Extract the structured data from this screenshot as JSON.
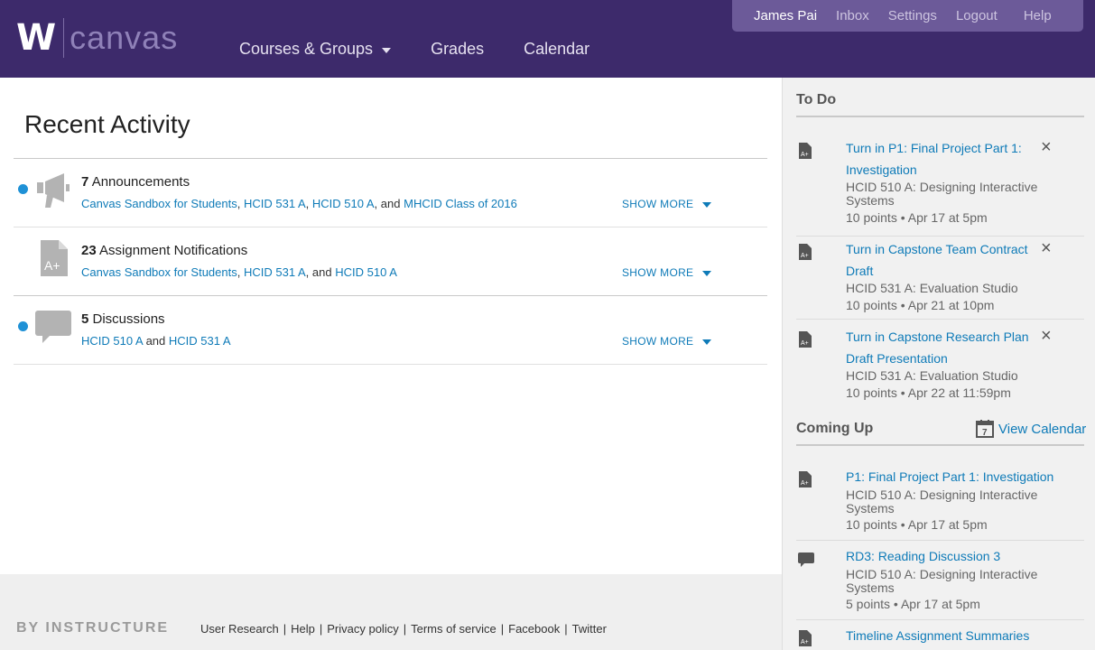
{
  "header": {
    "logo_mark": "W",
    "logo_text": "canvas",
    "nav": [
      {
        "label": "Courses & Groups"
      },
      {
        "label": "Grades"
      },
      {
        "label": "Calendar"
      }
    ],
    "user_nav": {
      "user": "James Pai",
      "inbox": "Inbox",
      "settings": "Settings",
      "logout": "Logout",
      "help": "Help"
    },
    "colors": {
      "bar": "#3d2a6b",
      "user_bar": "#6c5a99"
    }
  },
  "main": {
    "title": "Recent Activity",
    "activities": [
      {
        "count": "7",
        "label": "Announcements",
        "icon": "megaphone-icon",
        "links": [
          "Canvas Sandbox for Students",
          "HCID 531 A",
          "HCID 510 A",
          "MHCID Class of 2016"
        ],
        "show_more": "SHOW MORE",
        "unread": true
      },
      {
        "count": "23",
        "label": "Assignment Notifications",
        "icon": "assignment-icon",
        "links": [
          "Canvas Sandbox for Students",
          "HCID 531 A",
          "HCID 510 A"
        ],
        "show_more": "SHOW MORE",
        "unread": false
      },
      {
        "count": "5",
        "label": "Discussions",
        "icon": "discussion-icon",
        "links": [
          "HCID 510 A",
          "HCID 531 A"
        ],
        "show_more": "SHOW MORE",
        "unread": true
      }
    ],
    "separators": {
      "comma": ",",
      "and": "and"
    }
  },
  "footer": {
    "brand": "BY INSTRUCTURE",
    "links": [
      "User Research",
      "Help",
      "Privacy policy",
      "Terms of service",
      "Facebook",
      "Twitter"
    ]
  },
  "sidebar": {
    "todo_heading": "To Do",
    "todo": [
      {
        "title_line1": "Turn in P1: Final Project Part 1:",
        "title_line2": "Investigation",
        "course": "HCID 510 A: Designing Interactive Systems",
        "meta": "10 points • Apr 17 at 5pm",
        "close": "×"
      },
      {
        "title_line1": "Turn in Capstone Team Contract",
        "title_line2": "Draft",
        "course": "HCID 531 A: Evaluation Studio",
        "meta": "10 points • Apr 21 at 10pm",
        "close": "×"
      },
      {
        "title_line1": "Turn in Capstone Research Plan",
        "title_line2": "Draft Presentation",
        "course": "HCID 531 A: Evaluation Studio",
        "meta": "10 points • Apr 22 at 11:59pm",
        "close": "×"
      }
    ],
    "coming_heading": "Coming Up",
    "view_calendar": "View Calendar",
    "calendar_icon_day": "7",
    "coming": [
      {
        "title": "P1: Final Project Part 1: Investigation",
        "course": "HCID 510 A: Designing Interactive Systems",
        "meta": "10 points • Apr 17 at 5pm",
        "icon": "assignment-icon"
      },
      {
        "title": "RD3: Reading Discussion 3",
        "course": "HCID 510 A: Designing Interactive Systems",
        "meta": "5 points • Apr 17 at 5pm",
        "icon": "discussion-icon"
      },
      {
        "title": "Timeline Assignment Summaries",
        "icon": "assignment-icon"
      }
    ]
  }
}
